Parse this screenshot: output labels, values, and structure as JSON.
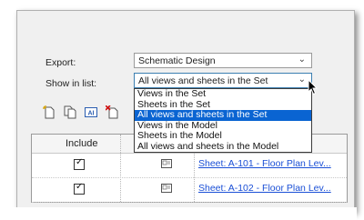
{
  "export": {
    "label": "Export:",
    "value": "Schematic Design"
  },
  "show_in_list": {
    "label": "Show in list:",
    "value": "All views and sheets in the Set",
    "options": [
      "Views in the Set",
      "Sheets in the Set",
      "All views and sheets in the Set",
      "Views in the Model",
      "Sheets in the Model",
      "All views and sheets in the Model"
    ],
    "selected_index": 2
  },
  "table": {
    "columns": [
      "Include"
    ],
    "rows": [
      {
        "checked": true,
        "name": "Sheet: A-101 - Floor Plan Lev..."
      },
      {
        "checked": true,
        "name": "Sheet: A-102 - Floor Plan Lev..."
      }
    ]
  },
  "toolbar": {
    "icons": [
      "new-set-icon",
      "duplicate-set-icon",
      "rename-set-icon",
      "delete-set-icon"
    ]
  },
  "colors": {
    "selection": "#0a64d2",
    "link": "#1a4fd6"
  }
}
